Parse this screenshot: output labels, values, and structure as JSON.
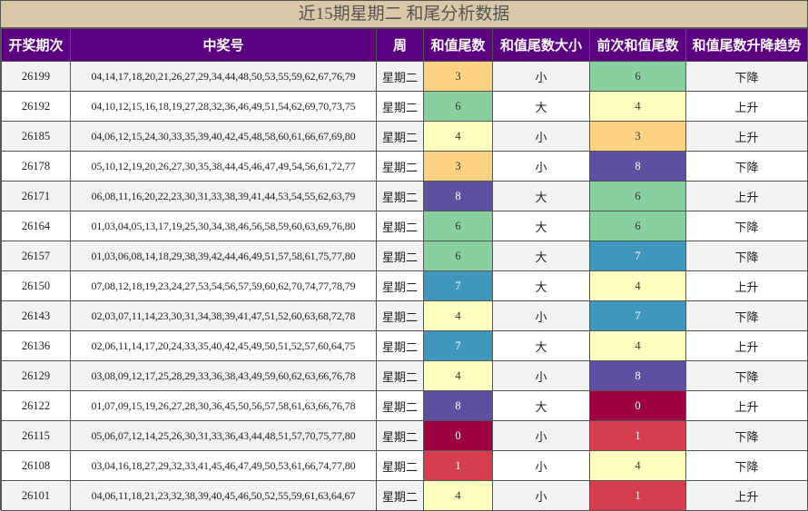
{
  "title": "近15期星期二 和尾分析数据",
  "headers": [
    "开奖期次",
    "中奖号",
    "周",
    "和值尾数",
    "和值尾数大小",
    "前次和值尾数",
    "和值尾数升降趋势"
  ],
  "digit_colors": {
    "0": "#9e0142",
    "1": "#d53e4f",
    "3": "#fdd383",
    "4": "#ffffbf",
    "6": "#88d0a0",
    "7": "#3f97be",
    "8": "#5e4fa2"
  },
  "digit_text_colors": {
    "0": "#ffffff",
    "1": "#ffffff",
    "3": "#333333",
    "4": "#333333",
    "6": "#333333",
    "7": "#ffffff",
    "8": "#ffffff"
  },
  "rows": [
    {
      "period": "26199",
      "numbers": "04,14,17,18,20,21,26,27,29,34,44,48,50,53,55,59,62,67,76,79",
      "weekday": "星期二",
      "tail": "3",
      "size": "小",
      "prev_tail": "6",
      "trend": "下降"
    },
    {
      "period": "26192",
      "numbers": "04,10,12,15,16,18,19,27,28,32,36,46,49,51,54,62,69,70,73,75",
      "weekday": "星期二",
      "tail": "6",
      "size": "大",
      "prev_tail": "4",
      "trend": "上升"
    },
    {
      "period": "26185",
      "numbers": "04,06,12,15,24,30,33,35,39,40,42,45,48,58,60,61,66,67,69,80",
      "weekday": "星期二",
      "tail": "4",
      "size": "小",
      "prev_tail": "3",
      "trend": "上升"
    },
    {
      "period": "26178",
      "numbers": "05,10,12,19,20,26,27,30,35,38,44,45,46,47,49,54,56,61,72,77",
      "weekday": "星期二",
      "tail": "3",
      "size": "小",
      "prev_tail": "8",
      "trend": "下降"
    },
    {
      "period": "26171",
      "numbers": "06,08,11,16,20,22,23,30,31,33,38,39,41,44,53,54,55,62,63,79",
      "weekday": "星期二",
      "tail": "8",
      "size": "大",
      "prev_tail": "6",
      "trend": "上升"
    },
    {
      "period": "26164",
      "numbers": "01,03,04,05,13,17,19,25,30,34,38,46,56,58,59,60,63,69,76,80",
      "weekday": "星期二",
      "tail": "6",
      "size": "大",
      "prev_tail": "6",
      "trend": "下降"
    },
    {
      "period": "26157",
      "numbers": "01,03,06,08,14,18,29,38,39,42,44,46,49,51,57,58,61,75,77,80",
      "weekday": "星期二",
      "tail": "6",
      "size": "大",
      "prev_tail": "7",
      "trend": "下降"
    },
    {
      "period": "26150",
      "numbers": "07,08,12,18,19,23,24,27,53,54,56,57,59,60,62,70,74,77,78,79",
      "weekday": "星期二",
      "tail": "7",
      "size": "大",
      "prev_tail": "4",
      "trend": "上升"
    },
    {
      "period": "26143",
      "numbers": "02,03,07,11,14,23,30,31,34,38,39,41,47,51,52,60,63,68,72,78",
      "weekday": "星期二",
      "tail": "4",
      "size": "小",
      "prev_tail": "7",
      "trend": "下降"
    },
    {
      "period": "26136",
      "numbers": "02,06,11,14,17,20,24,33,35,40,42,45,49,50,51,52,57,60,64,75",
      "weekday": "星期二",
      "tail": "7",
      "size": "大",
      "prev_tail": "4",
      "trend": "上升"
    },
    {
      "period": "26129",
      "numbers": "03,08,09,12,17,25,28,29,33,36,38,43,49,59,60,62,63,66,76,78",
      "weekday": "星期二",
      "tail": "4",
      "size": "小",
      "prev_tail": "8",
      "trend": "下降"
    },
    {
      "period": "26122",
      "numbers": "01,07,09,15,19,26,27,28,30,36,45,50,56,57,58,61,63,66,76,78",
      "weekday": "星期二",
      "tail": "8",
      "size": "大",
      "prev_tail": "0",
      "trend": "上升"
    },
    {
      "period": "26115",
      "numbers": "05,06,07,12,14,25,26,30,31,33,36,43,44,48,51,57,70,75,77,80",
      "weekday": "星期二",
      "tail": "0",
      "size": "小",
      "prev_tail": "1",
      "trend": "下降"
    },
    {
      "period": "26108",
      "numbers": "03,04,16,18,27,29,32,33,41,45,46,47,49,50,53,61,66,74,77,80",
      "weekday": "星期二",
      "tail": "1",
      "size": "小",
      "prev_tail": "4",
      "trend": "下降"
    },
    {
      "period": "26101",
      "numbers": "04,06,11,18,21,23,32,38,39,40,45,46,50,52,55,59,61,63,64,67",
      "weekday": "星期二",
      "tail": "4",
      "size": "小",
      "prev_tail": "1",
      "trend": "上升"
    }
  ]
}
